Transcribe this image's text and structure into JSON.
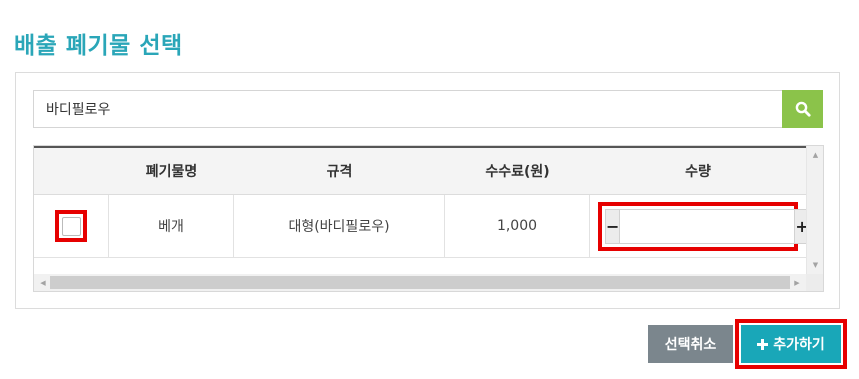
{
  "page": {
    "title": "배출 폐기물 선택"
  },
  "search": {
    "value": "바디필로우",
    "icon": "search-icon"
  },
  "table": {
    "headers": [
      "",
      "폐기물명",
      "규격",
      "수수료(원)",
      "수량"
    ],
    "rows": [
      {
        "checked": false,
        "name": "베개",
        "spec": "대형(바디필로우)",
        "fee": "1,000",
        "quantity": ""
      }
    ]
  },
  "stepper": {
    "minus": "−",
    "plus": "+"
  },
  "actions": {
    "cancel_label": "선택취소",
    "add_label": "추가하기",
    "add_icon": "plus-icon"
  },
  "colors": {
    "title": "#2aa6b8",
    "search_button": "#8bc34a",
    "add_button": "#19a7b8",
    "cancel_button": "#7b868d",
    "highlight": "#e60000"
  }
}
